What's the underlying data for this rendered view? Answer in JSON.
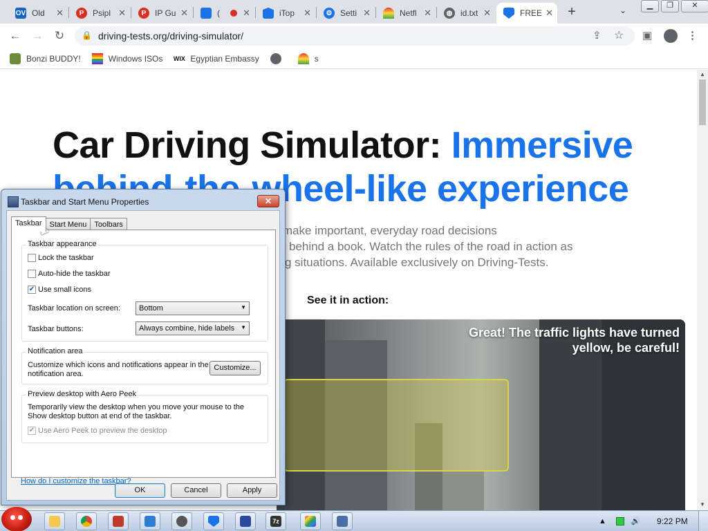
{
  "browser": {
    "tabs": [
      {
        "title": "Old",
        "favicon": "OV",
        "favicon_color": "#1565c0",
        "active": false
      },
      {
        "title": "Psipl",
        "favicon": "P",
        "favicon_color": "#d93025",
        "active": false
      },
      {
        "title": "IP Gu",
        "favicon": "P",
        "favicon_color": "#d93025",
        "active": false
      },
      {
        "title": "(",
        "favicon": "",
        "favicon_color": "#1a73e8",
        "active": false
      },
      {
        "title": "iTop",
        "favicon": "",
        "favicon_color": "#1a73e8",
        "active": false
      },
      {
        "title": "Setti",
        "favicon": "",
        "favicon_color": "#1a73e8",
        "active": false
      },
      {
        "title": "Netfl",
        "favicon": "",
        "favicon_color": "#e53935",
        "active": false
      },
      {
        "title": "id.txt",
        "favicon": "",
        "favicon_color": "#5f6368",
        "active": false
      },
      {
        "title": "FREE",
        "favicon": "",
        "favicon_color": "#1a73e8",
        "active": true
      }
    ],
    "url": "driving-tests.org/driving-simulator/",
    "bookmarks": [
      {
        "label": "Bonzi BUDDY!",
        "icon": "bonzi-icon"
      },
      {
        "label": "Windows ISOs",
        "icon": "rainbow-flag-icon"
      },
      {
        "label": "Egyptian Embassy",
        "icon": "wix-icon",
        "icon_text": "WIX"
      },
      {
        "label": "",
        "icon": "globe-icon"
      },
      {
        "label": "s",
        "icon": "rainbow-icon"
      }
    ],
    "window_buttons": {
      "minimize": "▁",
      "maximize": "❐",
      "close": "✕"
    }
  },
  "page": {
    "headline_black": "Car Driving Simulator: ",
    "headline_blue": "Immersive behind-the-wheel-like experience",
    "lead_lines": [
      "ver’s seat and make important, everyday road decisions",
      "behind a book. Watch the rules of the road in action as",
      "g situations. Available exclusively on Driving-Tests."
    ],
    "see_it": "See it in action:",
    "video_message": "Great! The traffic lights have turned yellow, be careful!"
  },
  "dialog": {
    "title": "Taskbar and Start Menu Properties",
    "close_label": "✕",
    "tabs": [
      "Taskbar",
      "Start Menu",
      "Toolbars"
    ],
    "appearance": {
      "legend": "Taskbar appearance",
      "lock": {
        "label": "Lock the taskbar",
        "checked": false
      },
      "autohide": {
        "label": "Auto-hide the taskbar",
        "checked": false
      },
      "small_icons": {
        "label": "Use small icons",
        "checked": true
      },
      "location_label": "Taskbar location on screen:",
      "location_value": "Bottom",
      "buttons_label": "Taskbar buttons:",
      "buttons_value": "Always combine, hide labels"
    },
    "notification": {
      "legend": "Notification area",
      "text": "Customize which icons and notifications appear in the notification area.",
      "customize_label": "Customize..."
    },
    "aero": {
      "legend": "Preview desktop with Aero Peek",
      "text": "Temporarily view the desktop when you move your mouse to the Show desktop button at end of the taskbar.",
      "checkbox_label": "Use Aero Peek to preview the desktop",
      "checked": true
    },
    "help_link": "How do I customize the taskbar?",
    "ok_label": "OK",
    "cancel_label": "Cancel",
    "apply_label": "Apply"
  },
  "taskbar": {
    "clock": "9:22 PM",
    "apps": [
      {
        "name": "explorer",
        "color": "#f2c94c"
      },
      {
        "name": "chrome",
        "color": "#db4437"
      },
      {
        "name": "media",
        "color": "#c0392b"
      },
      {
        "name": "rdp",
        "color": "#2d7dd2"
      },
      {
        "name": "psiphon",
        "color": "#555555"
      },
      {
        "name": "security",
        "color": "#1a73e8"
      },
      {
        "name": "notes",
        "color": "#2b4a9e"
      },
      {
        "name": "7zip",
        "color": "#333333",
        "text": "7z"
      },
      {
        "name": "colors",
        "color": "#7e57c2"
      },
      {
        "name": "control-panel",
        "color": "#4a6fa5"
      }
    ]
  }
}
